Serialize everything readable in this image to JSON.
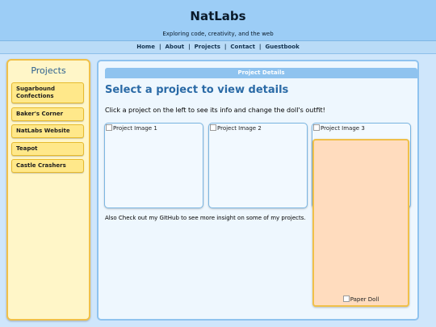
{
  "header": {
    "title": "NatLabs",
    "tagline": "Exploring code, creativity, and the web"
  },
  "nav": {
    "items": [
      "Home",
      "About",
      "Projects",
      "Contact",
      "Guestbook"
    ],
    "separator": "|"
  },
  "sidebar": {
    "title": "Projects",
    "items": [
      {
        "label": "Sugarbound Confections"
      },
      {
        "label": "Baker's Corner"
      },
      {
        "label": "NatLabs Website"
      },
      {
        "label": "Teapot"
      },
      {
        "label": "Castle Crashers"
      }
    ]
  },
  "main": {
    "bar_title": "Project Details",
    "heading": "Select a project to view details",
    "instruction": "Click a project on the left to see its info and change the doll's outfit!",
    "images": [
      {
        "alt": "Project Image 1"
      },
      {
        "alt": "Project Image 2"
      },
      {
        "alt": "Project Image 3"
      }
    ],
    "github_note": "Also Check out my GItHub to see more insight on some of my projects.",
    "doll_alt": "Paper Doll"
  },
  "colors": {
    "header_bg": "#9ccdf6",
    "sidebar_bg": "#fff6c8",
    "button_bg": "#ffe88a",
    "heading": "#2a6aa6",
    "doll_bg": "#ffdcbe"
  },
  "icons": {
    "broken_image": "broken-image-icon"
  }
}
